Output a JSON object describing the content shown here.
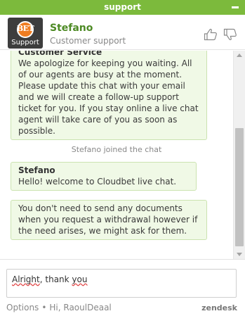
{
  "window": {
    "title": "support"
  },
  "agent": {
    "name": "Stefano",
    "role": "Customer support",
    "avatar_title": "BET",
    "avatar_subtitle": "Support"
  },
  "messages": [
    {
      "sender": "Customer Service",
      "text": "We apologize for keeping you waiting. All of our agents are busy at the moment. Please update this chat with your email and we will create a follow-up support ticket for you. If you stay online a live chat agent will take care of you as soon as possible."
    },
    {
      "system": "Stefano joined the chat"
    },
    {
      "sender": "Stefano",
      "text": "Hello! welcome to Cloudbet live chat."
    },
    {
      "text": "You don't need to send any documents when you request a withdrawal however if the need arises, we might ask for them."
    }
  ],
  "composer": {
    "value_part1": "Alright",
    "value_part2": ", thank ",
    "value_part3": "you"
  },
  "footer": {
    "options_label": "Options",
    "separator": "•",
    "greeting": "Hi, RaoulDeaal",
    "brand": "zendesk"
  },
  "colors": {
    "accent": "#7cba3c",
    "agent_name": "#4d8a24",
    "bubble_bg": "#f0f9e6",
    "bubble_border": "#cbe3b0",
    "logo_orange": "#f07d21"
  },
  "icons": {
    "minimize": "minimize-icon",
    "thumbs_up": "thumbs-up-icon",
    "thumbs_down": "thumbs-down-icon"
  }
}
